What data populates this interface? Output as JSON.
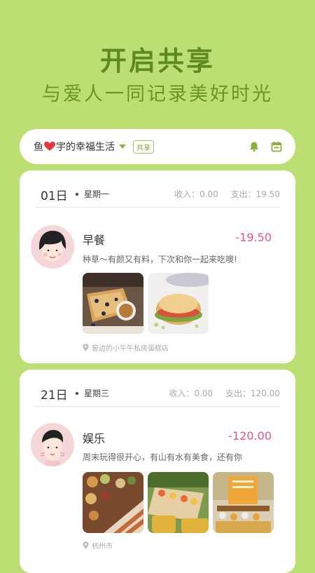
{
  "header": {
    "title": "开启共享",
    "subtitle": "与爱人一同记录美好时光"
  },
  "topbar": {
    "name_prefix": "鱼",
    "name_suffix": "宇的幸福生活",
    "share_badge": "共享",
    "icons": [
      "heart-icon",
      "dropdown-caret-icon",
      "bell-icon",
      "calendar-icon"
    ]
  },
  "days": [
    {
      "day": "01日",
      "weekday": "星期一",
      "income_label": "收入：",
      "income": "0.00",
      "expense_label": "支出：",
      "expense": "19.50",
      "entry": {
        "title": "早餐",
        "amount": "-19.50",
        "desc": "种草～有颜又有料，下次和你一起来吃噢!",
        "location": "窗边的小午午私房蛋糕店",
        "photos": [
          "waffle-with-berries-photo",
          "sandwich-photo"
        ]
      }
    },
    {
      "day": "21日",
      "weekday": "星期三",
      "income_label": "收入：",
      "income": "0.00",
      "expense_label": "支出：",
      "expense": "120.00",
      "entry": {
        "title": "娱乐",
        "amount": "-120.00",
        "desc": "周末玩得很开心，有山有水有美食，还有你",
        "location": "杭州市",
        "photos": [
          "picnic-food-photo",
          "outdoor-table-photo",
          "dessert-stand-photo"
        ]
      }
    }
  ],
  "colors": {
    "background": "#bcdf74",
    "accent_green": "#86b43a",
    "amount_red": "#e4567c"
  }
}
